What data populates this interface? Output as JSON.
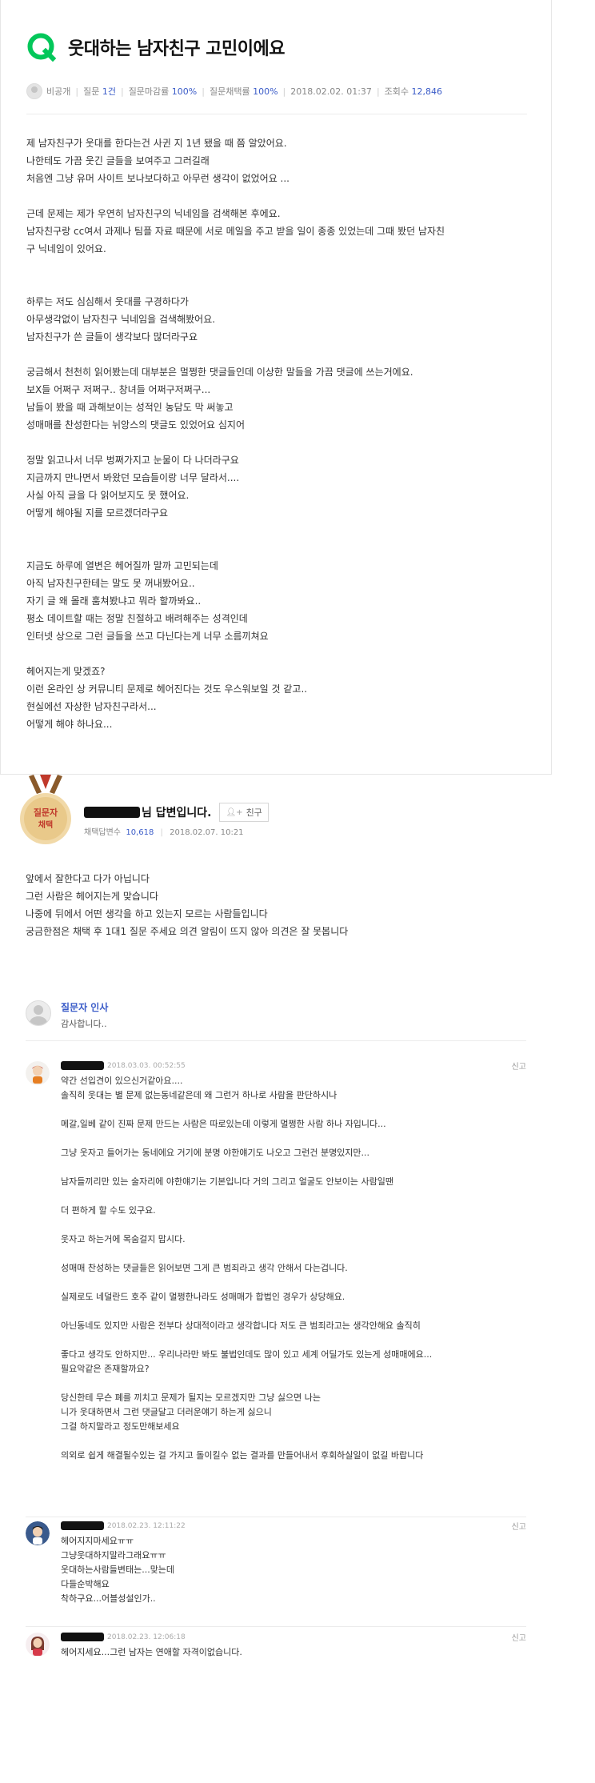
{
  "question": {
    "title": "웃대하는 남자친구 고민이에요",
    "meta": {
      "author": "비공개",
      "question_label": "질문",
      "question_count": "1건",
      "close_rate_label": "질문마감률",
      "close_rate": "100%",
      "adopt_rate_label": "질문채택률",
      "adopt_rate": "100%",
      "datetime": "2018.02.02. 01:37",
      "views_label": "조회수",
      "views": "12,846"
    },
    "body_lines": [
      "제 남자친구가 웃대를 한다는건 사귄 지 1년 됐을 때 쯤 알았어요.",
      "나한테도 가끔 웃긴 글들을 보여주고 그러길래",
      "처음엔 그냥 유머 사이트 보나보다하고 아무런 생각이 없었어요 ...",
      "",
      "근데 문제는 제가 우연히 남자친구의 닉네임을 검색해본 후에요.",
      "남자친구랑 cc여서 과제나 팀플 자료 때문에 서로 메일을 주고 받을 일이 종종 있었는데 그때 봤던 남자친",
      "구 닉네임이 있어요.",
      "",
      "",
      "하루는 저도 심심해서 웃대를 구경하다가",
      "아무생각없이 남자친구 닉네임을 검색해봤어요.",
      "남자친구가 쓴 글들이 생각보다 많더라구요",
      "",
      "궁금해서 천천히 읽어봤는데 대부분은 멀쩡한 댓글들인데 이상한 말들을 가끔 댓글에 쓰는거에요.",
      "보X들 어쩌구 저쩌구.. 창녀들 어쩌구저쩌구...",
      "남들이 봤을 때 과해보이는 성적인 농담도 막 써놓고",
      "성매매를 찬성한다는 뉘앙스의 댓글도 있었어요 심지어",
      "",
      "정말 읽고나서 너무 벙쪄가지고 눈물이 다 나더라구요",
      "지금까지 만나면서 봐왔던 모습들이랑 너무 달라서....",
      "사실 아직 글을 다 읽어보지도 못 했어요.",
      "어떻게 해야될 지를 모르겠더라구요",
      "",
      "",
      "지금도 하루에 열변은 헤어질까 말까 고민되는데",
      "아직 남자친구한테는 말도 못 꺼내봤어요..",
      "자기 글 왜 몰래 훔쳐봤냐고 뭐라 할까봐요..",
      "평소 데이트할 때는 정말 친절하고 배려해주는 성격인데",
      "인터넷 상으로 그런 글들을 쓰고 다닌다는게 너무 소름끼쳐요",
      "",
      "헤어지는게 맞겠죠?",
      "이런 온라인 상 커뮤니티 문제로 헤어진다는 것도 우스워보일 것 같고..",
      "현실에선 자상한 남자친구라서...",
      "어떻게 해야 하나요..."
    ]
  },
  "answer": {
    "medal_top": "질문자",
    "medal_bottom": "채택",
    "title_suffix": "님 답변입니다.",
    "friend_button": "친구",
    "adopt_label": "채택답변수",
    "adopt_count": "10,618",
    "datetime": "2018.02.07. 10:21",
    "body_lines": [
      "앞에서 잘한다고 다가 아닙니다",
      "그런 사람은 헤어지는게 맞습니다",
      "나중에 뒤에서 어떤 생각을 하고 있는지 모르는 사람들입니다",
      "",
      "궁금한점은 채택 후 1대1 질문 주세요 의견 알림이 뜨지 않아 의견은 잘 못봅니다"
    ]
  },
  "greeting": {
    "label": "질문자 인사",
    "text": "감사합니다.."
  },
  "report_label": "신고",
  "comments": [
    {
      "time": "2018.03.03. 00:52:55",
      "lines": [
        "약간 선입견이 있으신거같아요....",
        "솔직히 웃대는 별 문제 없는동네같은데 왜 그런거 하나로 사람을 판단하시나",
        "",
        "메갈,일베 같이 진짜 문제 만드는 사람은 따로있는데 이렇게 멀쩡한 사람 하나 자입니다...",
        "",
        "그냥 웃자고 들어가는 동네에요 거기에 분명 야한얘기도 나오고 그런건 분명있지만...",
        "",
        "남자들끼리만 있는 술자리에 야한얘기는 기본입니다 거의 그리고 얼굴도 안보이는 사람일땐",
        "",
        "더 편하게 할 수도 있구요.",
        "",
        "웃자고 하는거에 목숨걸지 맙시다.",
        "",
        "성매매 찬성하는 댓글들은 읽어보면 그게 큰 범죄라고 생각 안해서 다는겁니다.",
        "",
        "실제로도 네덜란드 호주 같이 멀쩡한나라도 성매매가 합법인 경우가 상당해요.",
        "",
        "아닌동네도 있지만 사람은 전부다 상대적이라고 생각합니다 저도 큰 범죄라고는 생각안해요 솔직히",
        "",
        "좋다고 생각도 안하지만... 우리나라만 봐도 불법인데도 많이 있고 세계 어딜가도 있는게 성매매에요...",
        "필요악같은 존재할까요?",
        "",
        "당신한테 무슨 폐를 끼치고 문제가 될지는 모르겠지만 그냥 싫으면 나는",
        "니가 웃대하면서 그런 댓글달고 더러운얘기 하는게 싫으니",
        "그걸 하지말라고 정도만해보세요",
        "",
        "의외로 쉽게 해결될수있는 걸 가지고 돌이킬수 없는 결과를 만들어내서 후회하실일이 없길 바랍니다"
      ]
    },
    {
      "time": "2018.02.23. 12:11:22",
      "lines": [
        "헤어지지마세요ㅠㅠ",
        "그냥웃대하지말라그래요ㅠㅠ",
        "웃대하는사람들변태는...맞는데",
        "다들순박해요",
        "착하구요...어블성설인가.."
      ]
    },
    {
      "time": "2018.02.23. 12:06:18",
      "lines": [
        "헤어지세요...그런 남자는 연애할 자격이없습니다."
      ]
    }
  ],
  "colors": {
    "brand_green": "#03c75a",
    "link_blue": "#3b5cc8",
    "medal_gold": "#e9c98a",
    "medal_red": "#c0392b"
  }
}
